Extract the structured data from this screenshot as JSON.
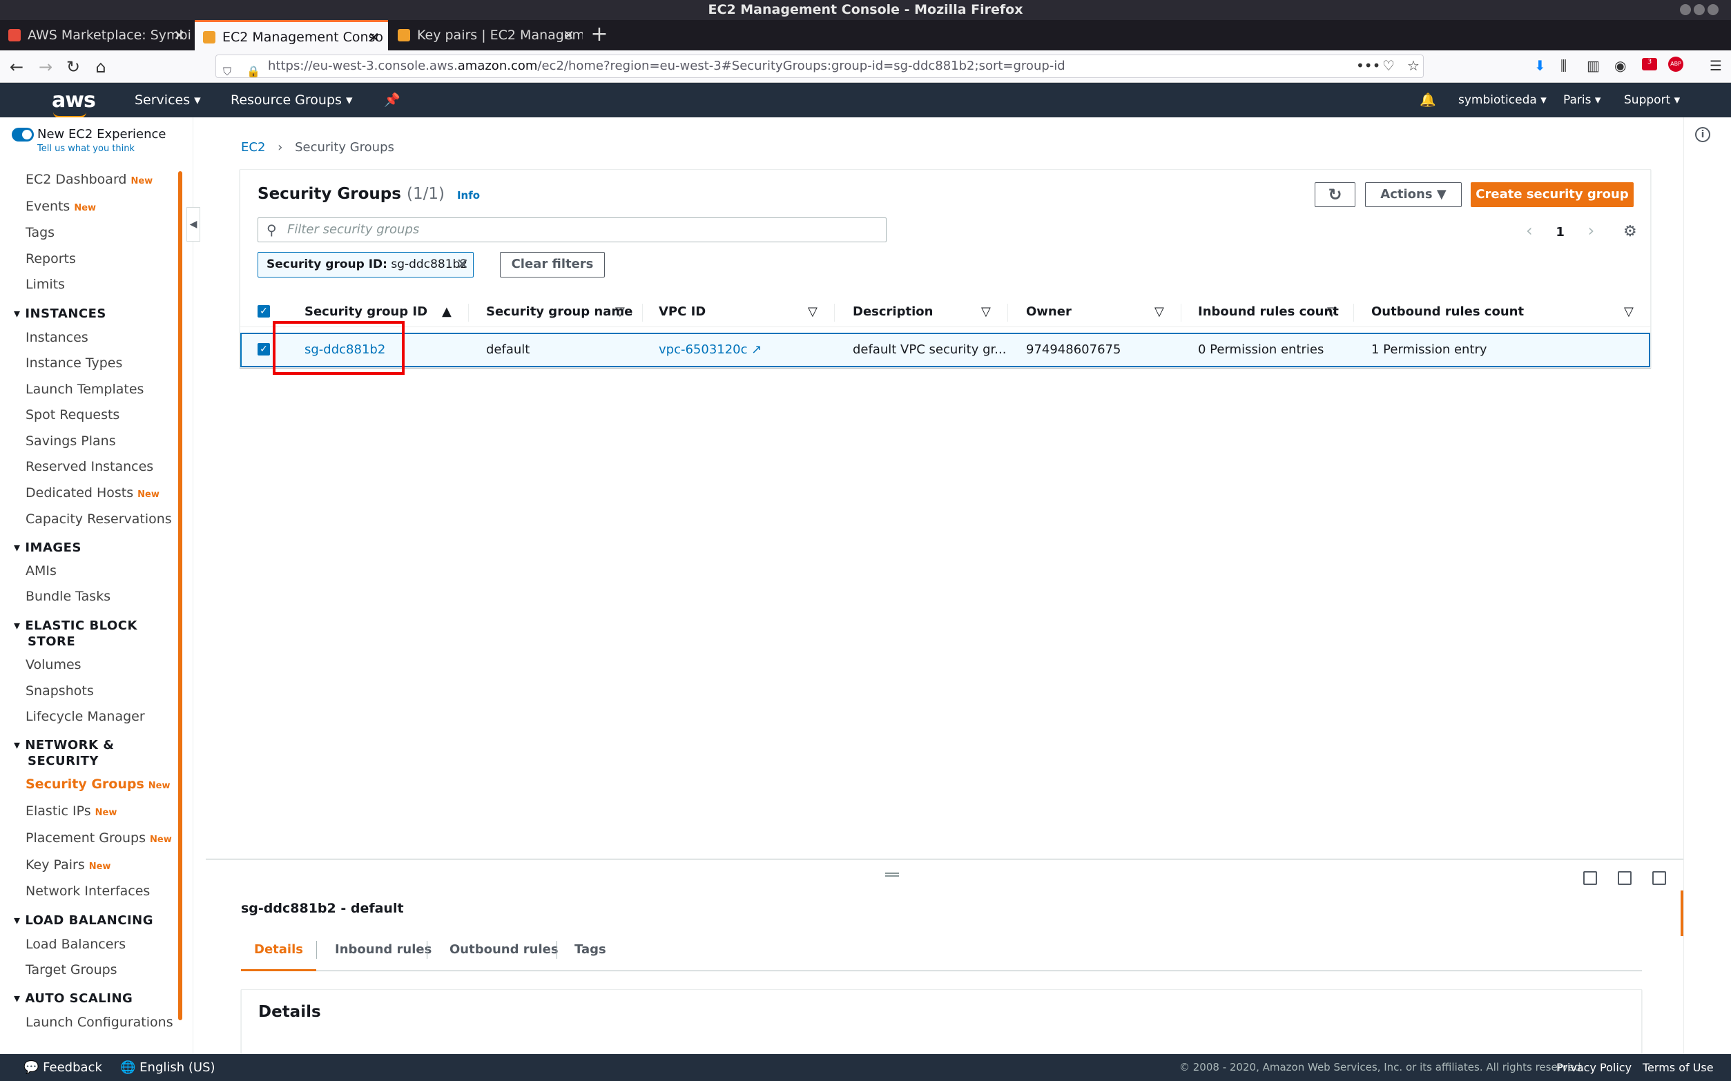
{
  "browser": {
    "window_title": "EC2 Management Console - Mozilla Firefox",
    "tabs": [
      {
        "label": "AWS Marketplace: Symbi"
      },
      {
        "label": "EC2 Management Conso"
      },
      {
        "label": "Key pairs | EC2 Managem"
      }
    ],
    "url_prefix": "https://eu-west-3.console.aws.",
    "url_domain": "amazon.com",
    "url_suffix": "/ec2/home?region=eu-west-3#SecurityGroups:group-id=sg-ddc881b2;sort=group-id",
    "badge_count": "3",
    "abp_label": "ABP"
  },
  "aws_header": {
    "logo": "aws",
    "services": "Services",
    "resource_groups": "Resource Groups",
    "user": "symbioticeda",
    "region": "Paris",
    "support": "Support"
  },
  "sidebar": {
    "toggle_label": "New EC2 Experience",
    "toggle_sub": "Tell us what you think",
    "new_badge": "New",
    "top_items": [
      "EC2 Dashboard",
      "Events",
      "Tags",
      "Reports",
      "Limits"
    ],
    "sections": {
      "instances": "INSTANCES",
      "images": "IMAGES",
      "ebs_1": "ELASTIC BLOCK",
      "ebs_2": "STORE",
      "net_1": "NETWORK &",
      "net_2": "SECURITY",
      "lb": "LOAD BALANCING",
      "as": "AUTO SCALING"
    },
    "instances_items": [
      "Instances",
      "Instance Types",
      "Launch Templates",
      "Spot Requests",
      "Savings Plans",
      "Reserved Instances",
      "Dedicated Hosts",
      "Capacity Reservations"
    ],
    "images_items": [
      "AMIs",
      "Bundle Tasks"
    ],
    "ebs_items": [
      "Volumes",
      "Snapshots",
      "Lifecycle Manager"
    ],
    "net_items": [
      "Security Groups",
      "Elastic IPs",
      "Placement Groups",
      "Key Pairs",
      "Network Interfaces"
    ],
    "lb_items": [
      "Load Balancers",
      "Target Groups"
    ],
    "as_items": [
      "Launch Configurations"
    ]
  },
  "breadcrumb": {
    "root": "EC2",
    "current": "Security Groups"
  },
  "panel": {
    "title": "Security Groups",
    "count": "(1/1)",
    "info": "Info",
    "actions": "Actions",
    "create": "Create security group",
    "filter_placeholder": "Filter security groups",
    "page": "1",
    "chip_key": "Security group ID:",
    "chip_value": "sg-ddc881b2",
    "clear_filters": "Clear filters"
  },
  "table": {
    "headers": [
      "Security group ID",
      "Security group name",
      "VPC ID",
      "Description",
      "Owner",
      "Inbound rules count",
      "Outbound rules count"
    ],
    "row": {
      "id": "sg-ddc881b2",
      "name": "default",
      "vpc": "vpc-6503120c",
      "description": "default VPC security gr...",
      "owner": "974948607675",
      "inbound": "0 Permission entries",
      "outbound": "1 Permission entry"
    }
  },
  "details": {
    "title": "sg-ddc881b2 - default",
    "tabs": [
      "Details",
      "Inbound rules",
      "Outbound rules",
      "Tags"
    ],
    "section_title": "Details"
  },
  "footer": {
    "feedback": "Feedback",
    "language": "English (US)",
    "copyright": "© 2008 - 2020, Amazon Web Services, Inc. or its affiliates. All rights reserved.",
    "privacy": "Privacy Policy",
    "terms": "Terms of Use"
  },
  "colors": {
    "accent": "#ec7211",
    "link": "#0073bb",
    "header": "#232f3e",
    "highlight": "#ee0000"
  }
}
